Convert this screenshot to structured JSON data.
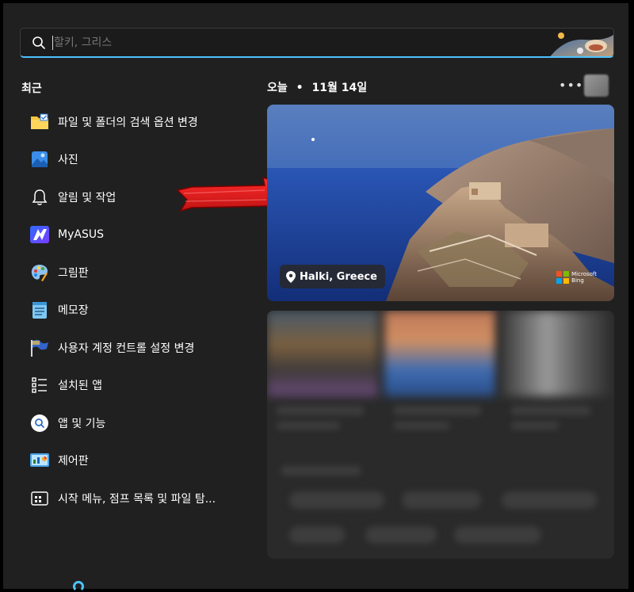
{
  "search": {
    "placeholder": "할키, 그리스"
  },
  "recent": {
    "title": "최근",
    "items": [
      {
        "label": "파일 및 폴더의 검색 옵션 변경",
        "icon": "folder-options-icon"
      },
      {
        "label": "사진",
        "icon": "photos-icon"
      },
      {
        "label": "알림 및 작업",
        "icon": "bell-icon"
      },
      {
        "label": "MyASUS",
        "icon": "myasus-icon"
      },
      {
        "label": "그림판",
        "icon": "paint-palette-icon"
      },
      {
        "label": "메모장",
        "icon": "notepad-icon"
      },
      {
        "label": "사용자 계정 컨트롤 설정 변경",
        "icon": "uac-flag-icon"
      },
      {
        "label": "설치된 앱",
        "icon": "installed-apps-icon"
      },
      {
        "label": "앱 및 기능",
        "icon": "apps-features-icon"
      },
      {
        "label": "제어판",
        "icon": "control-panel-icon"
      },
      {
        "label": "시작 메뉴, 점프 목록 및 파일 탐...",
        "icon": "start-settings-icon"
      }
    ]
  },
  "today": {
    "label": "오늘",
    "separator": "•",
    "date": "11월 14일",
    "more": "•••"
  },
  "hero": {
    "location": "Halki, Greece",
    "bing_line1": "Microsoft",
    "bing_line2": "Bing"
  },
  "colors": {
    "accent": "#4cc2ff",
    "background": "#202020",
    "annotation_arrow": "#e01e1e"
  }
}
